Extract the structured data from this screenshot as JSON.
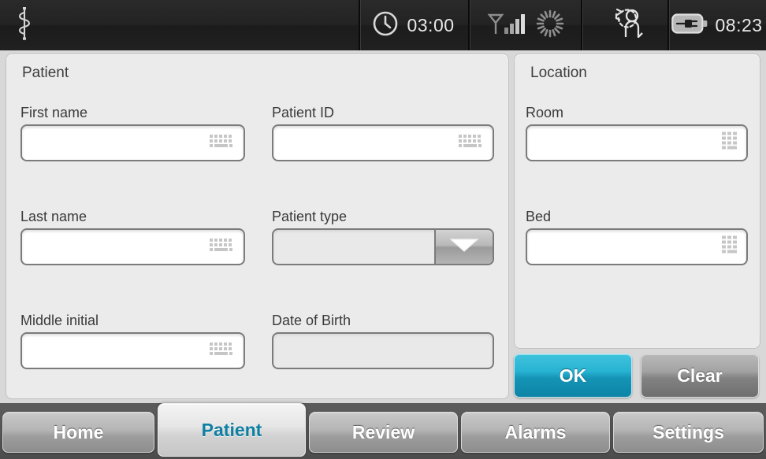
{
  "statusbar": {
    "logo_icon": "asclepius-rod-icon",
    "clock": {
      "icon": "clock-icon",
      "value": "03:00"
    },
    "network": {
      "antenna_icon": "antenna-signal-icon",
      "spinner_icon": "sunburst-spinner-icon"
    },
    "history": {
      "icon": "patient-history-clock-icon"
    },
    "battery": {
      "icon": "battery-charging-plug-icon",
      "value": "08:23"
    }
  },
  "patient_panel": {
    "title": "Patient",
    "fields": [
      {
        "label": "First name",
        "value": "",
        "icon": "keyboard-icon",
        "type": "text",
        "col": "left"
      },
      {
        "label": "Last name",
        "value": "",
        "icon": "keyboard-icon",
        "type": "text",
        "col": "left"
      },
      {
        "label": "Middle initial",
        "value": "",
        "icon": "keyboard-icon",
        "type": "text",
        "col": "left"
      },
      {
        "label": "Patient ID",
        "value": "",
        "icon": "keyboard-icon",
        "type": "text",
        "col": "right"
      },
      {
        "label": "Patient type",
        "value": "",
        "icon": "chevron-down-icon",
        "type": "dropdown",
        "col": "right"
      },
      {
        "label": "Date of Birth",
        "value": "",
        "icon": "",
        "type": "readonly",
        "col": "right"
      }
    ]
  },
  "location_panel": {
    "title": "Location",
    "fields": [
      {
        "label": "Room",
        "value": "",
        "icon": "numeric-keypad-icon",
        "type": "text"
      },
      {
        "label": "Bed",
        "value": "",
        "icon": "numeric-keypad-icon",
        "type": "text"
      }
    ]
  },
  "actions": {
    "ok_label": "OK",
    "clear_label": "Clear"
  },
  "tabs": [
    {
      "label": "Home",
      "active": false
    },
    {
      "label": "Patient",
      "active": true
    },
    {
      "label": "Review",
      "active": false
    },
    {
      "label": "Alarms",
      "active": false
    },
    {
      "label": "Settings",
      "active": false
    }
  ],
  "colors": {
    "accent_teal": "#1494b6",
    "active_tab_text": "#0e7fa3",
    "statusbar_bg": "#232323",
    "panel_bg": "#ebebeb",
    "content_bg": "#d8d8d8",
    "tabbar_bg": "#555555"
  }
}
